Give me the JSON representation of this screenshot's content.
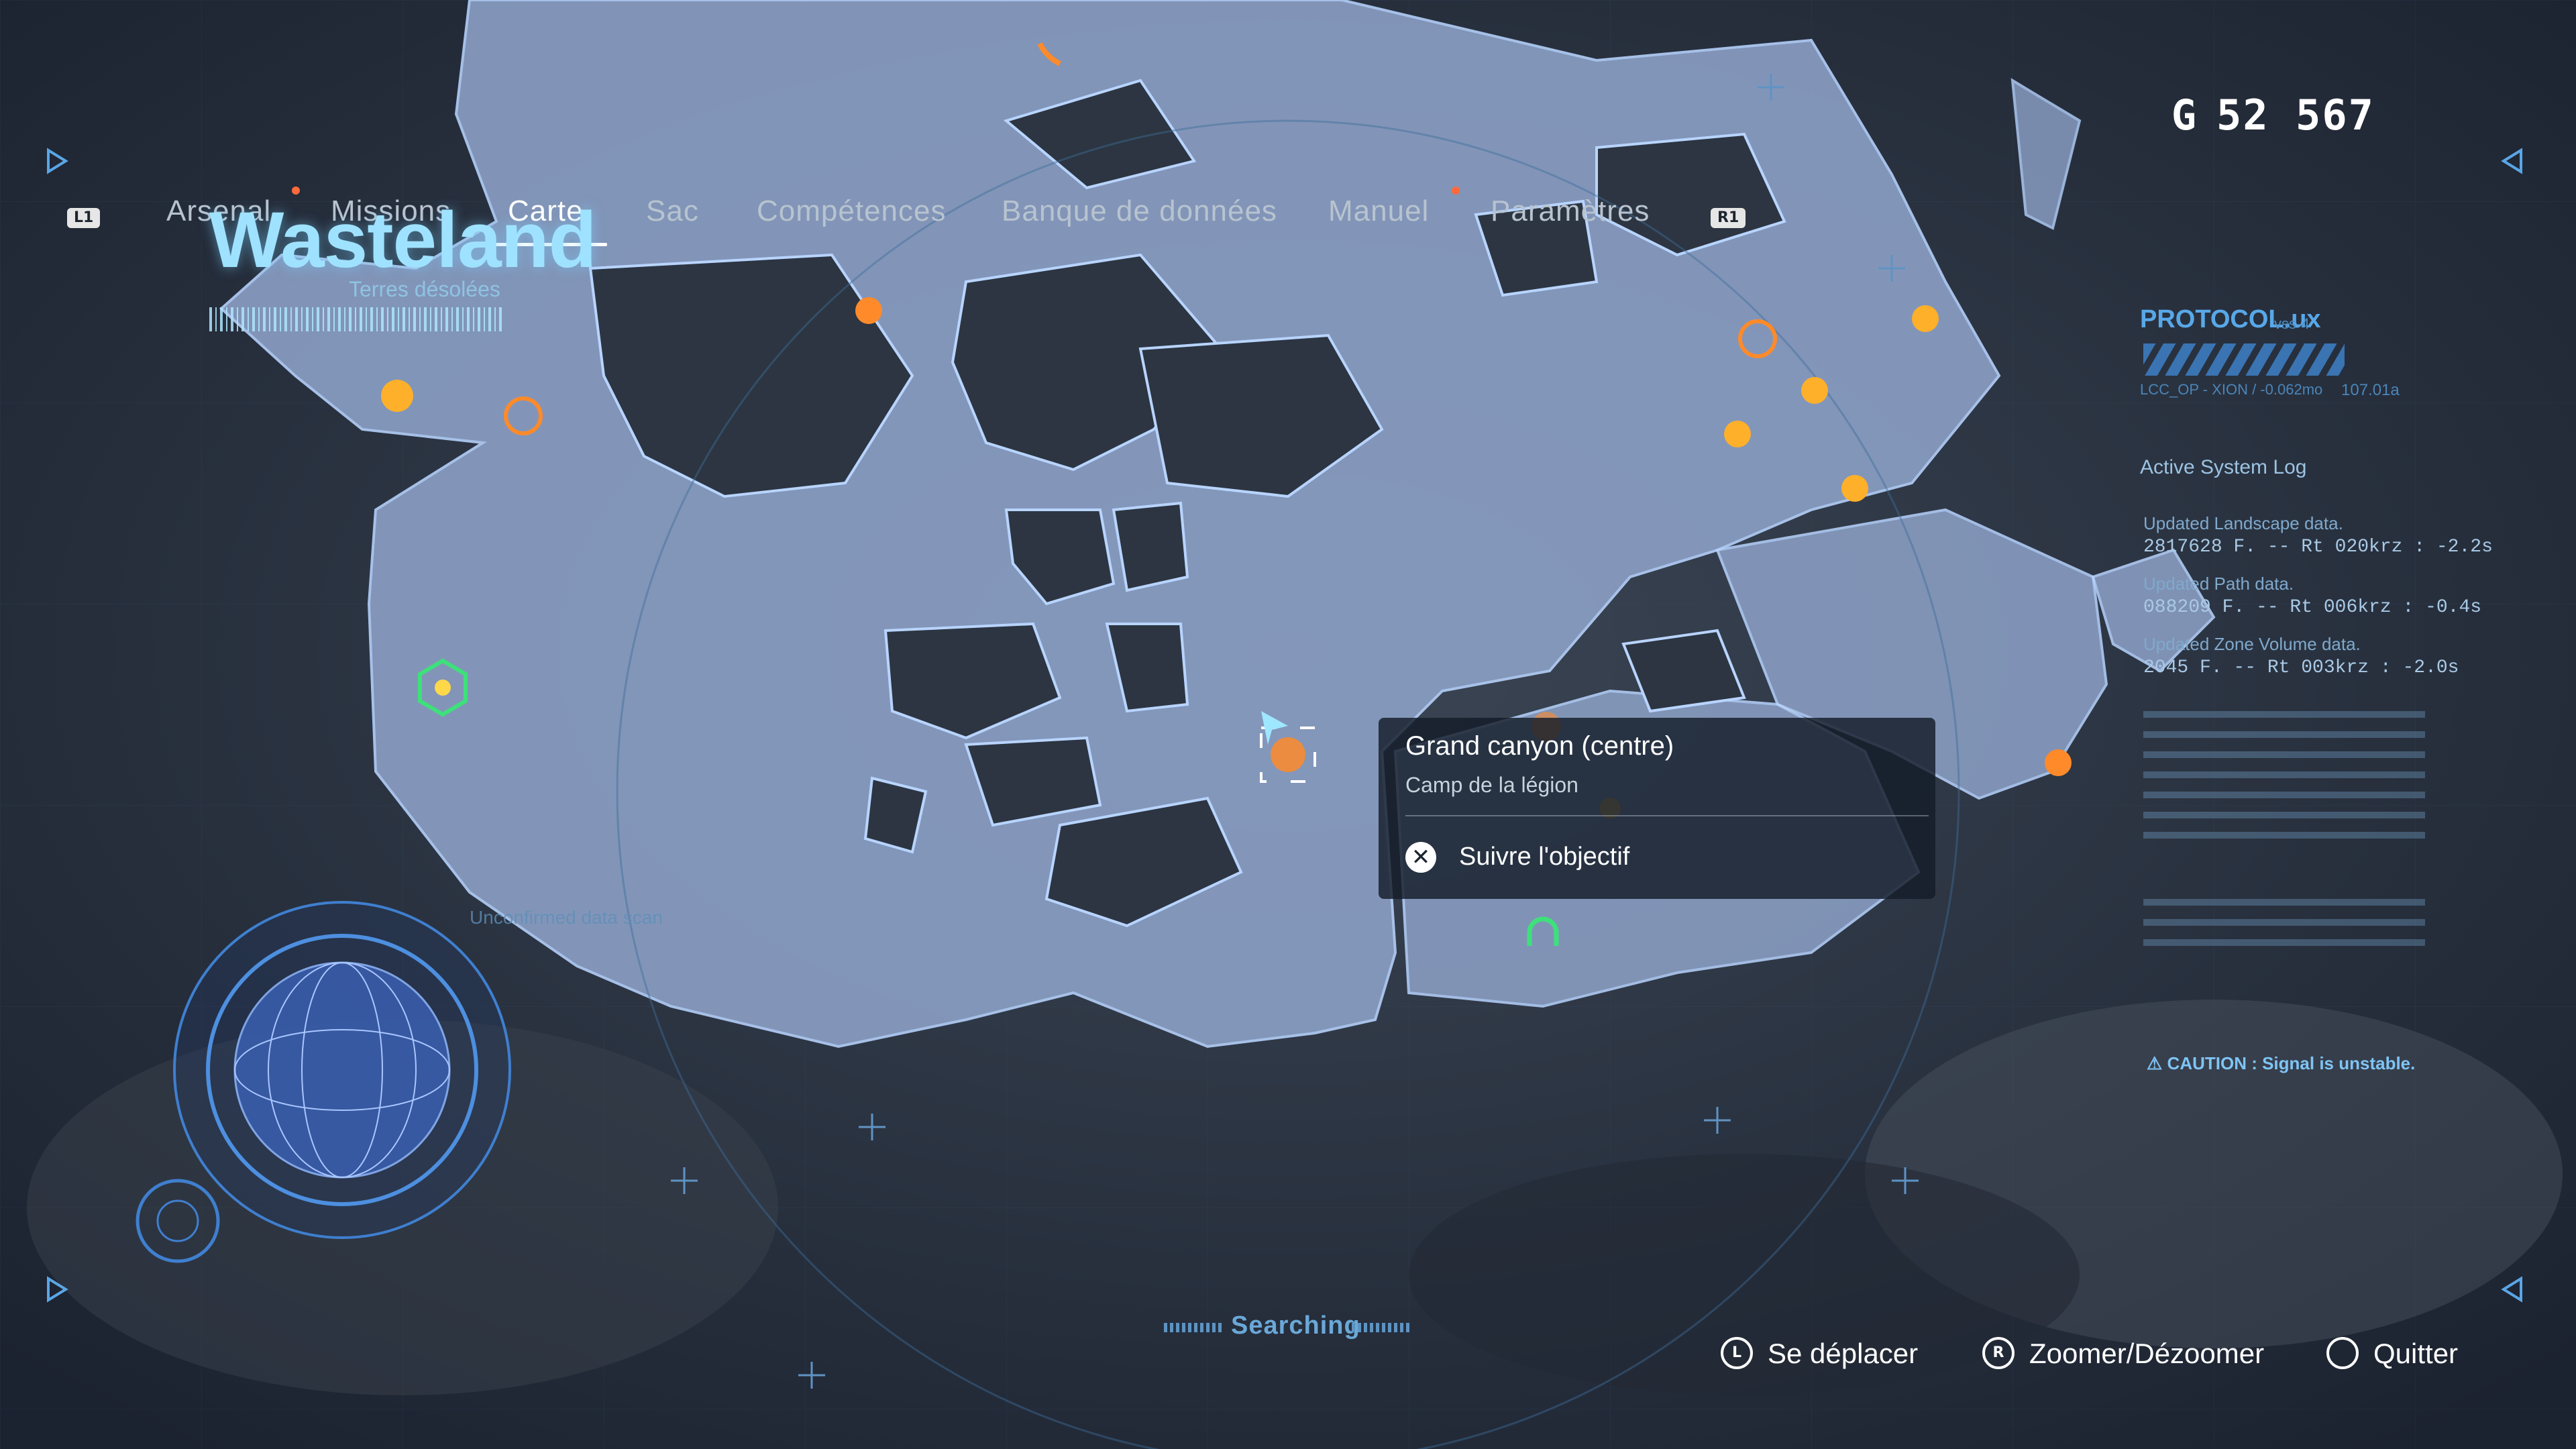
{
  "top_menu": {
    "left_button": "L1",
    "right_button": "R1",
    "tabs": [
      {
        "label": "Arsenal",
        "active": false
      },
      {
        "label": "Missions",
        "active": false
      },
      {
        "label": "Carte",
        "active": true
      },
      {
        "label": "Sac",
        "active": false
      },
      {
        "label": "Compétences",
        "active": false
      },
      {
        "label": "Banque de données",
        "active": false
      },
      {
        "label": "Manuel",
        "active": false
      },
      {
        "label": "Paramètres",
        "active": false
      }
    ],
    "currency_symbol": "G",
    "currency_amount": "52 567"
  },
  "region": {
    "name": "Wasteland",
    "subtitle": "Terres désolées"
  },
  "tooltip": {
    "title": "Grand canyon (centre)",
    "subtitle": "Camp de la légion",
    "action_label": "Suivre l'objectif",
    "action_button_icon": "cross-button-icon"
  },
  "hud_right": {
    "protocol_title": "PROTOCOL.ux",
    "protocol_version": "vss-4",
    "protocol_meta": "LCC_OP - XION / -0.062mo",
    "protocol_meta2": "107.01a",
    "log_title": "Active System Log",
    "log": [
      {
        "label": "Updated Landscape data.",
        "value": "2817628 F.  -- Rt 020krz  :  -2.2s"
      },
      {
        "label": "Updated Path data.",
        "value": "088209 F.  -- Rt 006krz  :  -0.4s"
      },
      {
        "label": "Updated Zone Volume data.",
        "value": "2045 F.  -- Rt 003krz  :  -2.0s"
      }
    ],
    "caution": "CAUTION : Signal is unstable."
  },
  "overlay_text": {
    "unconfirmed": "Unconfirmed data scan",
    "searching": "Searching"
  },
  "controls": [
    {
      "icon": "left-stick-icon",
      "glyph": "L",
      "label": "Se déplacer"
    },
    {
      "icon": "right-stick-icon",
      "glyph": "R",
      "label": "Zoomer/Dézoomer"
    },
    {
      "icon": "circle-button-icon",
      "glyph": "",
      "label": "Quitter"
    }
  ],
  "colors": {
    "explored_area": "#8fa3c8",
    "terrain": "#2c3541",
    "accent": "#9fe2ff",
    "marker_orange": "#ff8a2a",
    "marker_green": "#3ee07a"
  }
}
